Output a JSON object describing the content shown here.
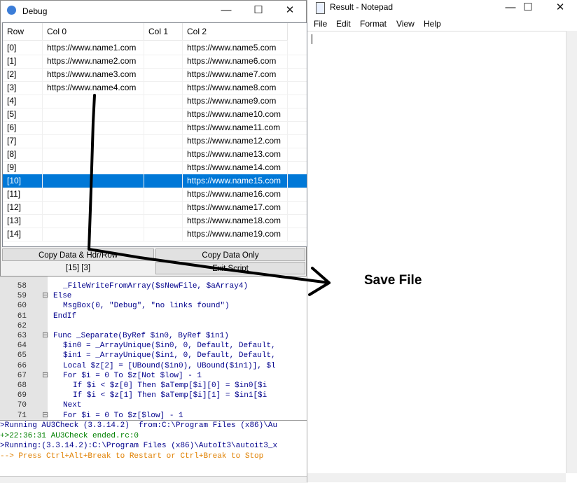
{
  "editor": {
    "lines": [
      {
        "num": "58",
        "fold": "",
        "code": "_FileWriteFromArray($sNewFile, $aArray4)",
        "indent": 2
      },
      {
        "num": "59",
        "fold": "⊟",
        "code": "Else",
        "indent": 0
      },
      {
        "num": "60",
        "fold": "",
        "code": "MsgBox(0, \"Debug\", \"no links found\")",
        "indent": 2
      },
      {
        "num": "61",
        "fold": "",
        "code": "EndIf",
        "indent": 0
      },
      {
        "num": "62",
        "fold": "",
        "code": "",
        "indent": 0
      },
      {
        "num": "63",
        "fold": "⊟",
        "code": "Func _Separate(ByRef $in0, ByRef $in1)",
        "indent": 0
      },
      {
        "num": "64",
        "fold": "",
        "code": "$in0 = _ArrayUnique($in0, 0, Default, Default,",
        "indent": 2
      },
      {
        "num": "65",
        "fold": "",
        "code": "$in1 = _ArrayUnique($in1, 0, Default, Default,",
        "indent": 2
      },
      {
        "num": "66",
        "fold": "",
        "code": "Local $z[2] = [UBound($in0), UBound($in1)], $l",
        "indent": 2
      },
      {
        "num": "67",
        "fold": "⊟",
        "code": "For $i = 0 To $z[Not $low] - 1",
        "indent": 2
      },
      {
        "num": "68",
        "fold": "",
        "code": "If $i < $z[0] Then $aTemp[$i][0] = $in0[$i",
        "indent": 4
      },
      {
        "num": "69",
        "fold": "",
        "code": "If $i < $z[1] Then $aTemp[$i][1] = $in1[$i",
        "indent": 4
      },
      {
        "num": "70",
        "fold": "",
        "code": "Next",
        "indent": 2
      },
      {
        "num": "71",
        "fold": "⊟",
        "code": "For $i = 0 To $z[$low] - 1",
        "indent": 2
      }
    ]
  },
  "console": {
    "lines": [
      {
        "text": ">Running AU3Check (3.3.14.2)  from:C:\\Program Files (x86)\\Au",
        "color": "#00008b"
      },
      {
        "text": "+>22:36:31 AU3Check ended.rc:0",
        "color": "#008000"
      },
      {
        "text": ">Running:(3.3.14.2):C:\\Program Files (x86)\\AutoIt3\\autoit3_x",
        "color": "#00008b"
      },
      {
        "text": "--> Press Ctrl+Alt+Break to Restart or Ctrl+Break to Stop",
        "color": "#e08000"
      }
    ]
  },
  "notepad": {
    "title": "Result - Notepad",
    "menu": [
      "File",
      "Edit",
      "Format",
      "View",
      "Help"
    ],
    "content": ""
  },
  "debug": {
    "title": "Debug",
    "columns": [
      "Row",
      "Col 0",
      "Col 1",
      "Col 2"
    ],
    "rows": [
      [
        "[0]",
        "https://www.name1.com",
        "",
        "https://www.name5.com"
      ],
      [
        "[1]",
        "https://www.name2.com",
        "",
        "https://www.name6.com"
      ],
      [
        "[2]",
        "https://www.name3.com",
        "",
        "https://www.name7.com"
      ],
      [
        "[3]",
        "https://www.name4.com",
        "",
        "https://www.name8.com"
      ],
      [
        "[4]",
        "",
        "",
        "https://www.name9.com"
      ],
      [
        "[5]",
        "",
        "",
        "https://www.name10.com"
      ],
      [
        "[6]",
        "",
        "",
        "https://www.name11.com"
      ],
      [
        "[7]",
        "",
        "",
        "https://www.name12.com"
      ],
      [
        "[8]",
        "",
        "",
        "https://www.name13.com"
      ],
      [
        "[9]",
        "",
        "",
        "https://www.name14.com"
      ],
      [
        "[10]",
        "",
        "",
        "https://www.name15.com"
      ],
      [
        "[11]",
        "",
        "",
        "https://www.name16.com"
      ],
      [
        "[12]",
        "",
        "",
        "https://www.name17.com"
      ],
      [
        "[13]",
        "",
        "",
        "https://www.name18.com"
      ],
      [
        "[14]",
        "",
        "",
        "https://www.name19.com"
      ]
    ],
    "selected_row": 10,
    "buttons": {
      "copy_data_hdr": "Copy Data & Hdr/Row",
      "copy_data_only": "Copy Data Only",
      "exit_script": "Exit Script"
    },
    "status": "[15] [3]"
  },
  "annotation": {
    "label": "Save File"
  },
  "window_controls": {
    "minimize": "—",
    "maximize": "☐",
    "close": "✕"
  }
}
